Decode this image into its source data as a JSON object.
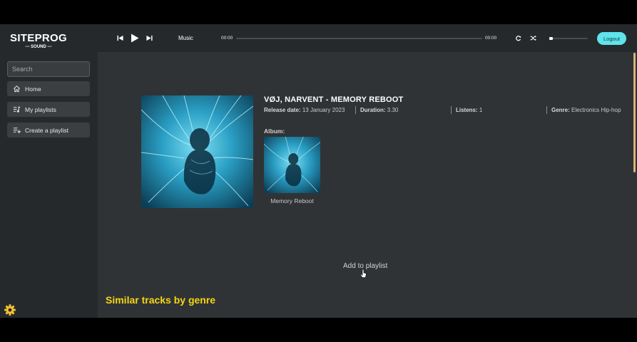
{
  "sidebar": {
    "logo_main": "SITEPROG",
    "logo_sub": "--- SOUND ---",
    "search_placeholder": "Search",
    "items": [
      {
        "label": "Home",
        "icon": "home-icon"
      },
      {
        "label": "My playlists",
        "icon": "playlist-icon"
      },
      {
        "label": "Create a playlist",
        "icon": "add-playlist-icon"
      }
    ],
    "settings_icon": "gear-icon"
  },
  "player": {
    "track_label": "Music",
    "current_time": "00:00",
    "total_time": "00:00",
    "progress": 0,
    "volume": 0.05,
    "logout_label": "Logout",
    "accent_color": "#5fe4ec"
  },
  "track": {
    "title": "VØJ, NARVENT - MEMORY REBOOT",
    "release_label": "Release date:",
    "release_value": "13 January 2023",
    "duration_label": "Duration:",
    "duration_value": "3.30",
    "listens_label": "Listens:",
    "listens_value": "1",
    "genre_label": "Genre:",
    "genre_value": "Electronics Hip-hop",
    "album_heading": "Album:",
    "album_name": "Memory Reboot",
    "add_to_playlist": "Add to playlist"
  },
  "similar": {
    "heading": "Similar tracks by genre",
    "heading_color": "#f5d614"
  }
}
